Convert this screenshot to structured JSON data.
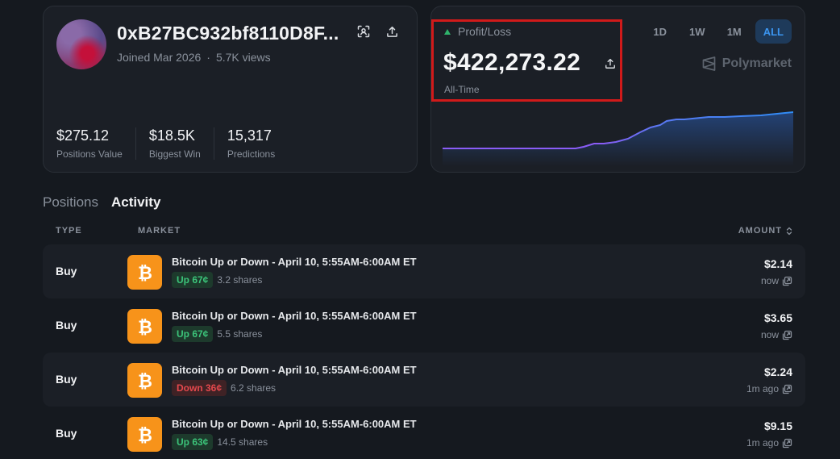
{
  "profile": {
    "address": "0xB27BC932bf8110D8F...",
    "joined": "Joined Mar 2026",
    "separator": "·",
    "views": "5.7K views",
    "stats": [
      {
        "value": "$275.12",
        "label": "Positions Value"
      },
      {
        "value": "$18.5K",
        "label": "Biggest Win"
      },
      {
        "value": "15,317",
        "label": "Predictions"
      }
    ]
  },
  "pnl": {
    "label": "Profit/Loss",
    "value": "$422,273.22",
    "period": "All-Time",
    "brand": "Polymarket",
    "ranges": [
      {
        "label": "1D",
        "active": false
      },
      {
        "label": "1W",
        "active": false
      },
      {
        "label": "1M",
        "active": false
      },
      {
        "label": "ALL",
        "active": true
      }
    ],
    "colors": {
      "line_start": "#8a5cf6",
      "line_end": "#2f8cf5",
      "positive": "#2fb36b"
    }
  },
  "tabs": [
    {
      "label": "Positions",
      "active": false
    },
    {
      "label": "Activity",
      "active": true
    }
  ],
  "table": {
    "headers": {
      "type": "TYPE",
      "market": "MARKET",
      "amount": "AMOUNT"
    },
    "rows": [
      {
        "type": "Buy",
        "market": "Bitcoin Up or Down - April 10, 5:55AM-6:00AM ET",
        "outcome": "Up 67¢",
        "direction": "up",
        "shares": "3.2 shares",
        "amount": "$2.14",
        "time": "now"
      },
      {
        "type": "Buy",
        "market": "Bitcoin Up or Down - April 10, 5:55AM-6:00AM ET",
        "outcome": "Up 67¢",
        "direction": "up",
        "shares": "5.5 shares",
        "amount": "$3.65",
        "time": "now"
      },
      {
        "type": "Buy",
        "market": "Bitcoin Up or Down - April 10, 5:55AM-6:00AM ET",
        "outcome": "Down 36¢",
        "direction": "down",
        "shares": "6.2 shares",
        "amount": "$2.24",
        "time": "1m ago"
      },
      {
        "type": "Buy",
        "market": "Bitcoin Up or Down - April 10, 5:55AM-6:00AM ET",
        "outcome": "Up 63¢",
        "direction": "up",
        "shares": "14.5 shares",
        "amount": "$9.15",
        "time": "1m ago"
      }
    ]
  }
}
